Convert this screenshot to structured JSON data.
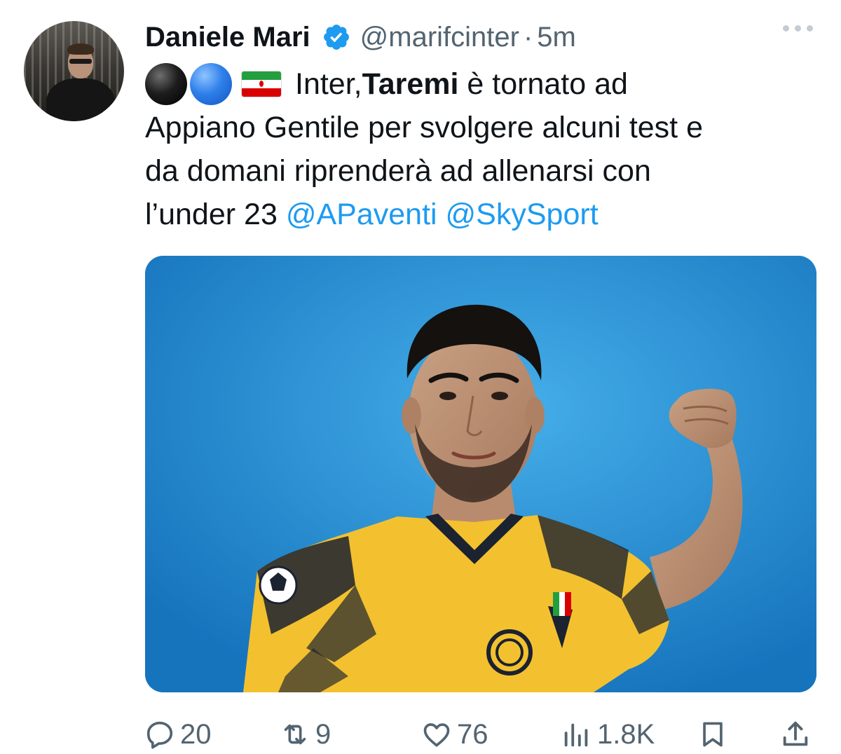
{
  "author": {
    "name": "Daniele Mari",
    "handle": "@marifcinter",
    "separator": "·",
    "timestamp": "5m",
    "verified": true
  },
  "tweet": {
    "emojis": [
      "black-circle",
      "blue-circle",
      "iran-flag"
    ],
    "line1_pre": "Inter, ",
    "line1_bold": "Taremi",
    "line1_post": " è tornato ad",
    "line2": "Appiano Gentile per svolgere alcuni test e",
    "line3": "da domani riprenderà ad allenarsi con",
    "line4": "l’under 23 ",
    "mention1": "@APaventi",
    "mention2": "@SkySport"
  },
  "actions": {
    "replies": "20",
    "reposts": "9",
    "likes": "76",
    "views": "1.8K"
  },
  "colors": {
    "accent": "#1d9bf0",
    "secondary_text": "#536471",
    "jersey_yellow": "#f3c12f",
    "background_blue": "#2590d6"
  }
}
